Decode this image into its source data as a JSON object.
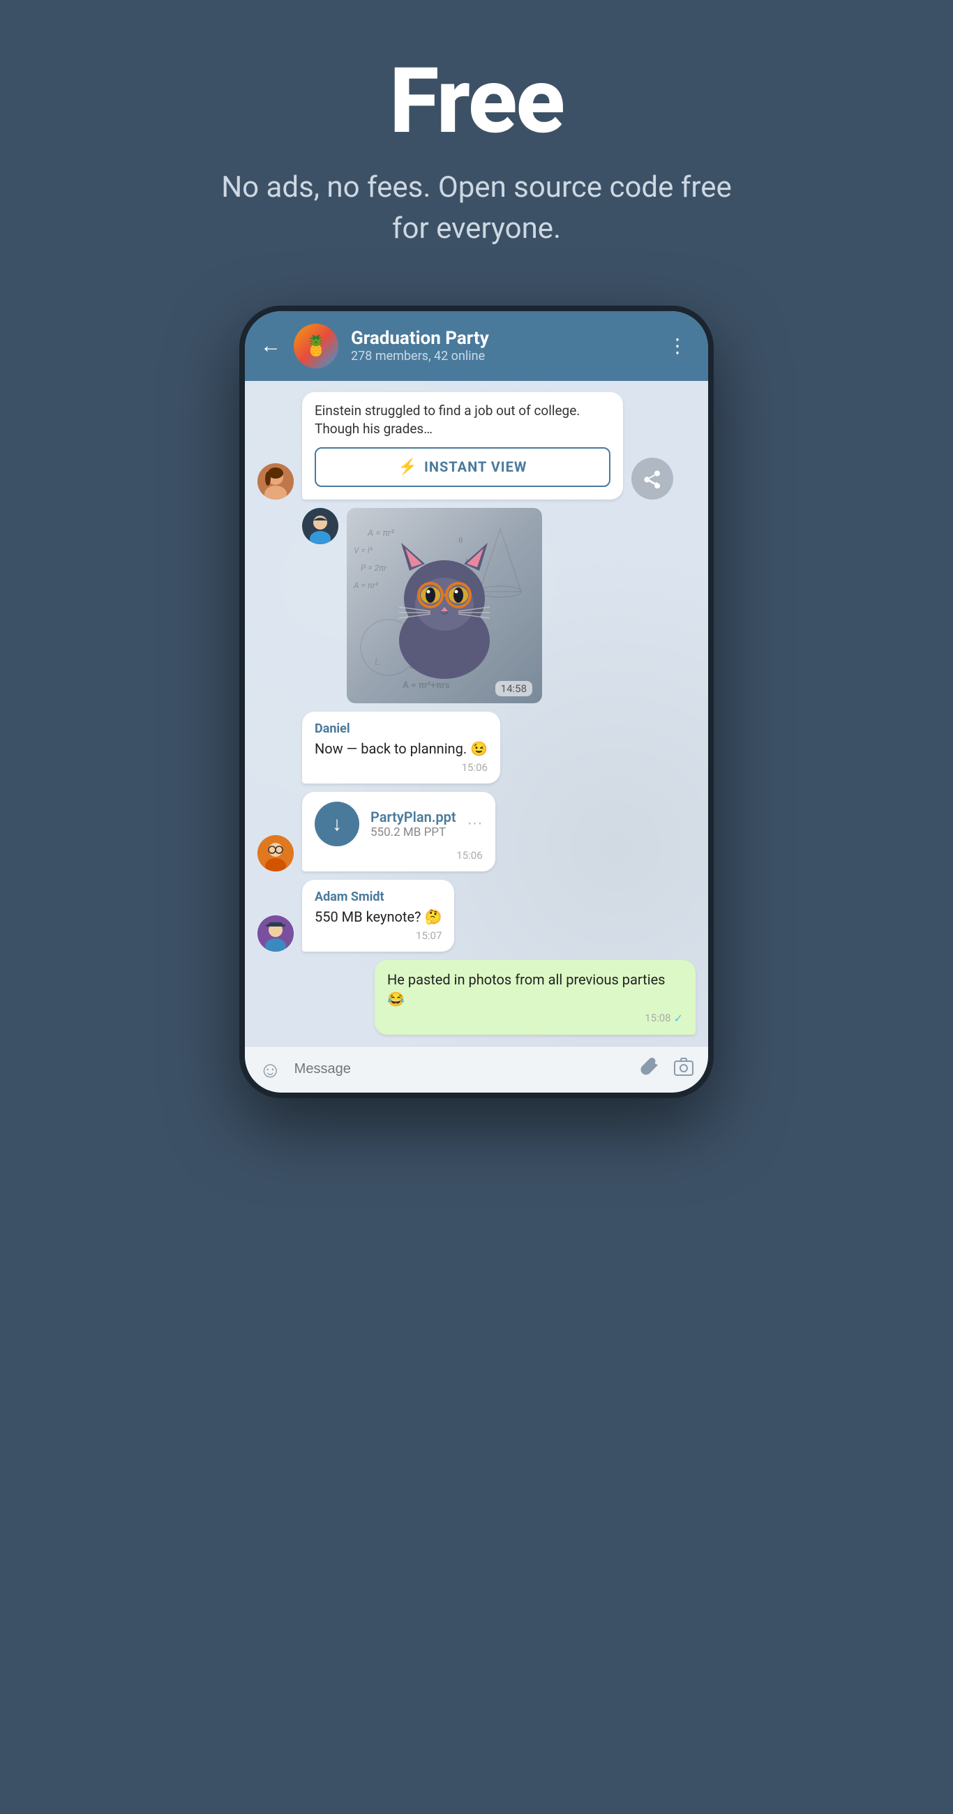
{
  "page": {
    "background_color": "#3d5166",
    "hero": {
      "title": "Free",
      "subtitle": "No ads, no fees. Open source code free for everyone."
    },
    "phone": {
      "header": {
        "back_label": "←",
        "group_name": "Graduation Party",
        "group_info": "278 members, 42 online",
        "more_icon": "⋮",
        "group_emoji": "🍍"
      },
      "messages": [
        {
          "id": "article-msg",
          "type": "article",
          "text": "Einstein struggled to find a job out of college. Though his grades…",
          "instant_view_label": "INSTANT VIEW"
        },
        {
          "id": "sticker-msg",
          "type": "sticker",
          "time": "14:58"
        },
        {
          "id": "daniel-msg",
          "type": "text",
          "sender": "Daniel",
          "text": "Now — back to planning. 😉",
          "time": "15:06"
        },
        {
          "id": "file-msg",
          "type": "file",
          "file_name": "PartyPlan.ppt",
          "file_size": "550.2 MB PPT",
          "time": "15:06"
        },
        {
          "id": "adam-msg",
          "type": "text",
          "sender": "Adam Smidt",
          "text": "550 MB keynote? 🤔",
          "time": "15:07"
        },
        {
          "id": "outgoing-msg",
          "type": "outgoing",
          "text": "He pasted in photos from all previous parties 😂",
          "time": "15:08",
          "tick": "✓"
        }
      ],
      "input_bar": {
        "placeholder": "Message",
        "emoji_icon": "☺",
        "attach_icon": "📎",
        "camera_icon": "◎"
      }
    }
  }
}
